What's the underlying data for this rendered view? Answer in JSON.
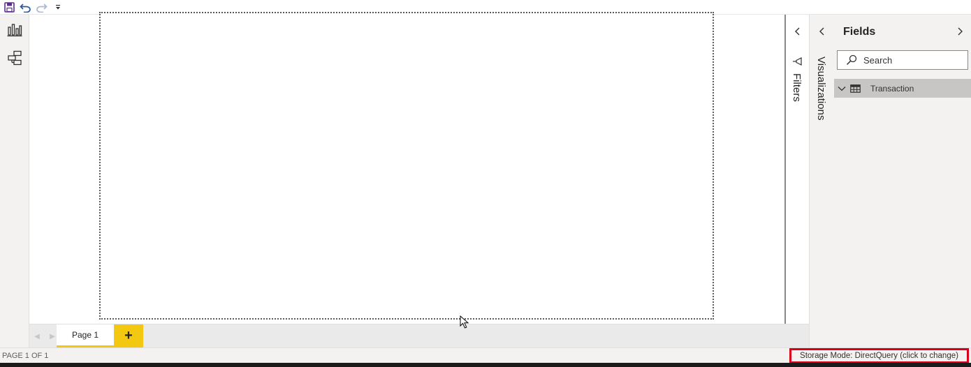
{
  "page_tabs": {
    "active_label": "Page 1",
    "add_label": "+"
  },
  "panes": {
    "filters_label": "Filters",
    "visualizations_label": "Visualizations"
  },
  "fields": {
    "title": "Fields",
    "search_placeholder": "Search",
    "tables": [
      {
        "name": "Transaction",
        "expanded": false
      }
    ]
  },
  "status": {
    "page_count": "PAGE 1 OF 1",
    "storage_mode": "Storage Mode: DirectQuery (click to change)"
  },
  "colors": {
    "accent_yellow": "#f2c811",
    "highlight_red": "#d8001b",
    "pane_bg": "#f3f2f1",
    "selected_row": "#c8c6c4"
  },
  "icons": {
    "save": "save-icon",
    "undo": "undo-icon",
    "redo": "redo-icon",
    "customize": "customize-dropdown-icon",
    "report_view": "report-view-icon",
    "model_view": "model-view-icon",
    "filter": "filter-icon",
    "search": "search-icon",
    "table": "table-icon"
  }
}
